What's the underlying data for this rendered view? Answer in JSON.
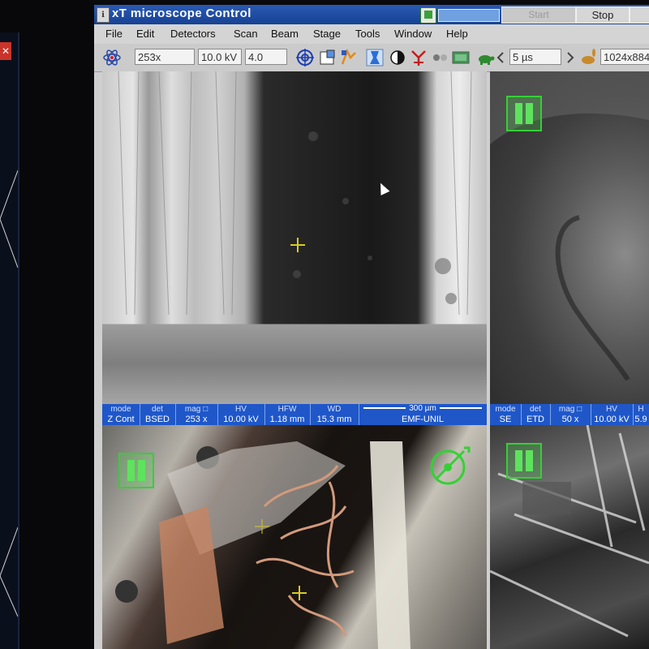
{
  "window": {
    "title": "xT microscope Control",
    "start_label": "Start",
    "stop_label": "Stop"
  },
  "menu": [
    "File",
    "Edit",
    "Detectors",
    "Scan",
    "Beam",
    "Stage",
    "Tools",
    "Window",
    "Help"
  ],
  "toolbar": {
    "magnification": "253x",
    "voltage": "10.0 kV",
    "spot_size": "4.0",
    "dwell_time": "5 µs",
    "resolution": "1024x884"
  },
  "quad1": {
    "databar": [
      {
        "key": "mode",
        "value": "Z Cont"
      },
      {
        "key": "det",
        "value": "BSED"
      },
      {
        "key": "mag □",
        "value": "253 x"
      },
      {
        "key": "HV",
        "value": "10.00 kV"
      },
      {
        "key": "HFW",
        "value": "1.18 mm"
      },
      {
        "key": "WD",
        "value": "15.3 mm"
      }
    ],
    "scale_label": "300 µm",
    "label": "EMF-UNIL"
  },
  "quad2": {
    "databar": [
      {
        "key": "mode",
        "value": "SE"
      },
      {
        "key": "det",
        "value": "ETD"
      },
      {
        "key": "mag □",
        "value": "50 x"
      },
      {
        "key": "HV",
        "value": "10.00 kV"
      },
      {
        "key": "H",
        "value": "5.9"
      }
    ]
  },
  "colors": {
    "accent_green": "#35d035",
    "databar_blue": "#1f57c9",
    "title_blue": "#174293"
  }
}
